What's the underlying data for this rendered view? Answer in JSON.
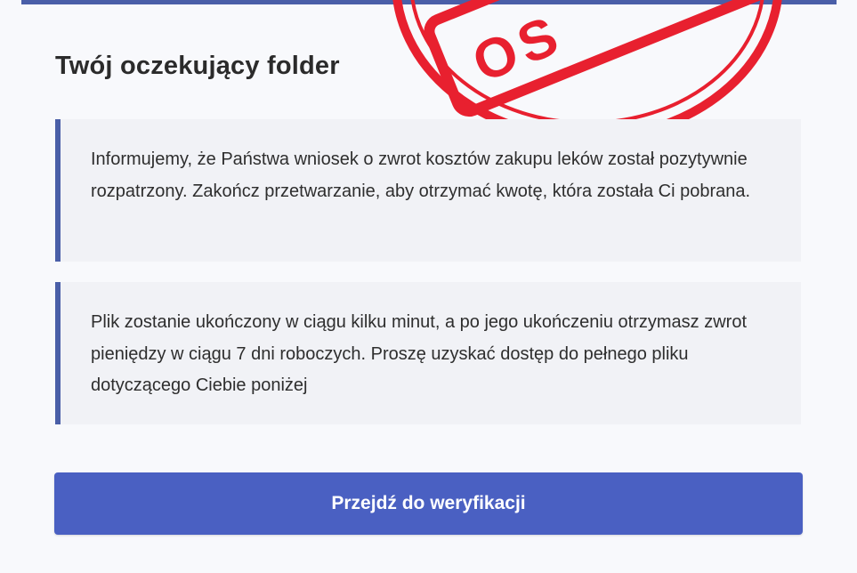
{
  "title": "Twój oczekujący folder",
  "notices": [
    "Informujemy, że Państwa wniosek o zwrot kosztów zakupu leków został pozytywnie rozpatrzony. Zakończ przetwarzanie, aby otrzymać kwotę, która została Ci pobrana.",
    "Plik zostanie ukończony w ciągu kilku minut, a po jego ukończeniu otrzymasz zwrot pieniędzy w ciągu 7 dni roboczych. Proszę uzyskać dostęp do pełnego pliku dotyczącego Ciebie poniżej"
  ],
  "cta_label": "Przejdź do weryfikacji",
  "stamp": {
    "text": "OS",
    "color": "#e8202f"
  },
  "colors": {
    "accent": "#4a5fa8",
    "button": "#4a60c2",
    "stamp": "#e8202f"
  }
}
